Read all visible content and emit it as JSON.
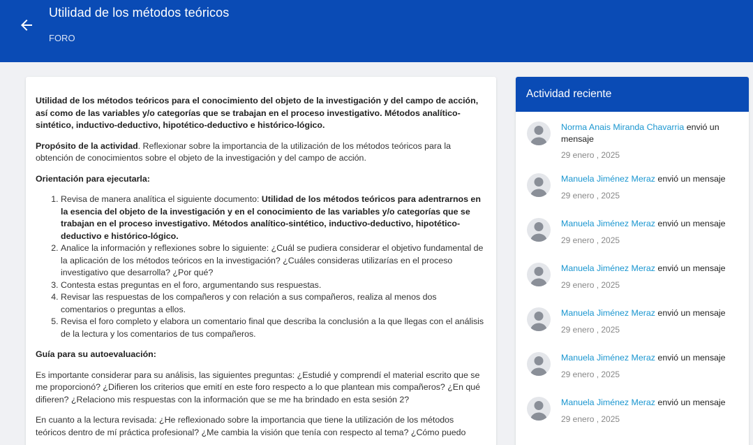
{
  "header": {
    "title": "Utilidad de los métodos teóricos",
    "subtitle": "FORO",
    "back_icon": "arrow-left-icon",
    "background": "#0a4bb5"
  },
  "main": {
    "intro": "Utilidad de los métodos teóricos para el conocimiento del objeto de la investigación y del campo de acción, así como de las variables y/o categorías que se trabajan en el proceso investigativo. Métodos analítico-sintético, inductivo-deductivo, hipotético-deductivo e histórico-lógico.",
    "purpose_label": "Propósito de la actividad",
    "purpose_text": ". Reflexionar sobre la importancia de la utilización de los métodos teóricos para la obtención de conocimientos sobre el objeto de la investigación y del campo de acción.",
    "orientation_label": "Orientación para ejecutarla:",
    "steps": {
      "s1_text": "Revisa de manera analítica el siguiente documento: ",
      "s1_bold": "Utilidad de los métodos teóricos para adentrarnos en la esencia del objeto de la investigación y en el conocimiento de las variables y/o categorías que se trabajan en el proceso investigativo. Métodos analítico-sintético, inductivo-deductivo, hipotético-deductivo e histórico-lógico.",
      "s2": "Analice la información y reflexiones sobre lo siguiente: ¿Cuál se pudiera considerar el objetivo fundamental de la aplicación de los métodos teóricos en la investigación? ¿Cuáles consideras utilizarías en el proceso investigativo que desarrolla? ¿Por qué?",
      "s3": "Contesta estas preguntas en el foro, argumentando sus respuestas.",
      "s4": "Revisar las respuestas de los compañeros y con relación a sus compañeros,   realiza al menos dos comentarios o preguntas a ellos.",
      "s5": "Revisa el foro completo y elabora un comentario final que describa la conclusión a la que llegas con el análisis de la lectura y los comentarios de tus compañeros."
    },
    "guide_label": "Guía para su autoevaluación:",
    "guide_text": "Es importante considerar para su análisis, las siguientes preguntas: ¿Estudié y comprendí el material escrito que se me proporcionó? ¿Difieren los criterios que emití en este foro respecto a lo que plantean mis compañeros? ¿En qué difieren?  ¿Relaciono mis respuestas con la información que se me ha brindado en esta sesión 2?",
    "reading_text": "En cuanto a la lectura revisada: ¿He reflexionado sobre  la importancia que tiene la utilización de los métodos teóricos dentro de mí práctica profesional? ¿Me cambia la visión que tenía con respecto al tema? ¿Cómo puedo"
  },
  "activity": {
    "title": "Actividad reciente",
    "avatar_icon": "user-avatar-icon",
    "link_color": "#1a96d0",
    "items": [
      {
        "user": "Norma Anais Miranda Chavarria",
        "action": " envió un mensaje",
        "date": "29 enero , 2025"
      },
      {
        "user": "Manuela Jiménez Meraz",
        "action": " envió un mensaje",
        "date": "29 enero , 2025"
      },
      {
        "user": "Manuela Jiménez Meraz",
        "action": " envió un mensaje",
        "date": "29 enero , 2025"
      },
      {
        "user": "Manuela Jiménez Meraz",
        "action": " envió un mensaje",
        "date": "29 enero , 2025"
      },
      {
        "user": "Manuela Jiménez Meraz",
        "action": " envió un mensaje",
        "date": "29 enero , 2025"
      },
      {
        "user": "Manuela Jiménez Meraz",
        "action": " envió un mensaje",
        "date": "29 enero , 2025"
      },
      {
        "user": "Manuela Jiménez Meraz",
        "action": " envió un mensaje",
        "date": "29 enero , 2025"
      }
    ]
  }
}
